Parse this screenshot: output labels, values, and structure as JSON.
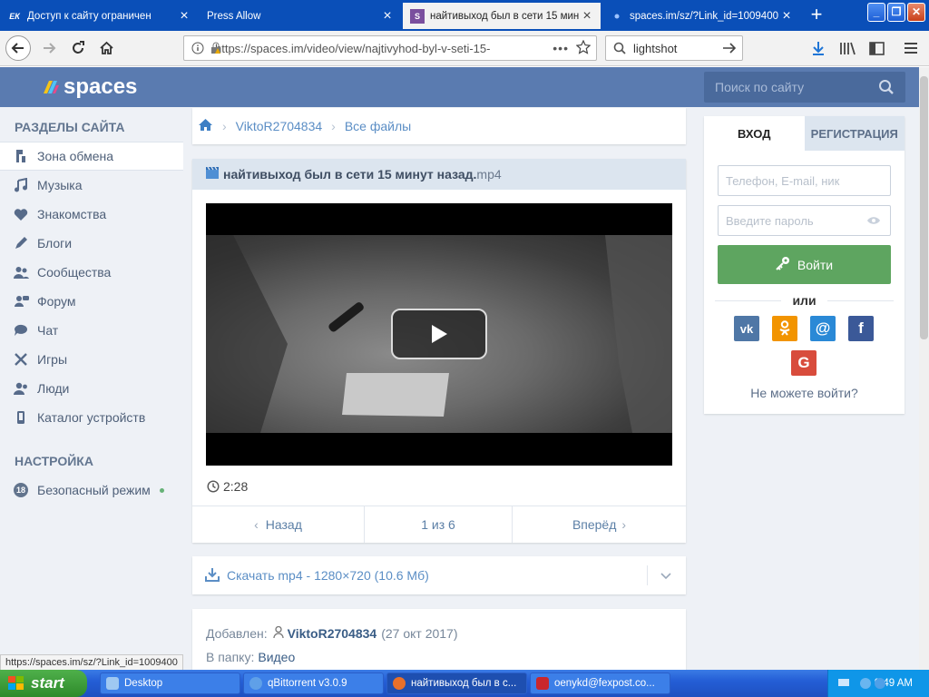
{
  "browser": {
    "tabs": [
      {
        "label": "Доступ к сайту ограничен",
        "favicon": "ЕК"
      },
      {
        "label": "Press Allow"
      },
      {
        "label": "найтивыход был в сети 15 мин",
        "favicon": "S"
      },
      {
        "label": "spaces.im/sz/?Link_id=1009400"
      }
    ],
    "url": "https://spaces.im/video/view/najtivyhod-byl-v-seti-15-",
    "search_value": "lightshot",
    "status_url": "https://spaces.im/sz/?Link_id=1009400"
  },
  "site": {
    "logo": "spaces",
    "search_placeholder": "Поиск по сайту",
    "accent": "#5a7bb0"
  },
  "sidebar": {
    "section_title": "РАЗДЕЛЫ САЙТА",
    "items": [
      {
        "label": "Зона обмена"
      },
      {
        "label": "Музыка"
      },
      {
        "label": "Знакомства"
      },
      {
        "label": "Блоги"
      },
      {
        "label": "Сообщества"
      },
      {
        "label": "Форум"
      },
      {
        "label": "Чат"
      },
      {
        "label": "Игры"
      },
      {
        "label": "Люди"
      },
      {
        "label": "Каталог устройств"
      }
    ],
    "settings_title": "НАСТРОЙКА",
    "safe_mode": {
      "badge": "18",
      "label": "Безопасный режим"
    }
  },
  "breadcrumb": {
    "user": "ViktoR2704834",
    "folder": "Все файлы"
  },
  "file": {
    "title": "найтивыход был в сети 15 минут назад.",
    "ext": "mp4",
    "duration": "2:28",
    "prev": "Назад",
    "page": "1 из 6",
    "next": "Вперёд",
    "download": "Скачать mp4 - 1280×720 (10.6 Мб)",
    "added_label": "Добавлен:",
    "added_user": "ViktoR2704834",
    "added_date": "(27 окт 2017)",
    "folder_label": "В папку:",
    "folder_value": "Видео"
  },
  "login": {
    "tab_login": "ВХОД",
    "tab_register": "РЕГИСТРАЦИЯ",
    "login_placeholder": "Телефон, E-mail, ник",
    "password_placeholder": "Введите пароль",
    "submit": "Войти",
    "or": "или",
    "cant_login": "Не можете войти?",
    "login_color": "#5ea560"
  },
  "taskbar": {
    "start": "start",
    "items": [
      {
        "label": "Desktop"
      },
      {
        "label": "qBittorrent v3.0.9"
      },
      {
        "label": "найтивыход был в с..."
      },
      {
        "label": "oenykd@fexpost.co..."
      }
    ],
    "time": "9:49 AM"
  }
}
